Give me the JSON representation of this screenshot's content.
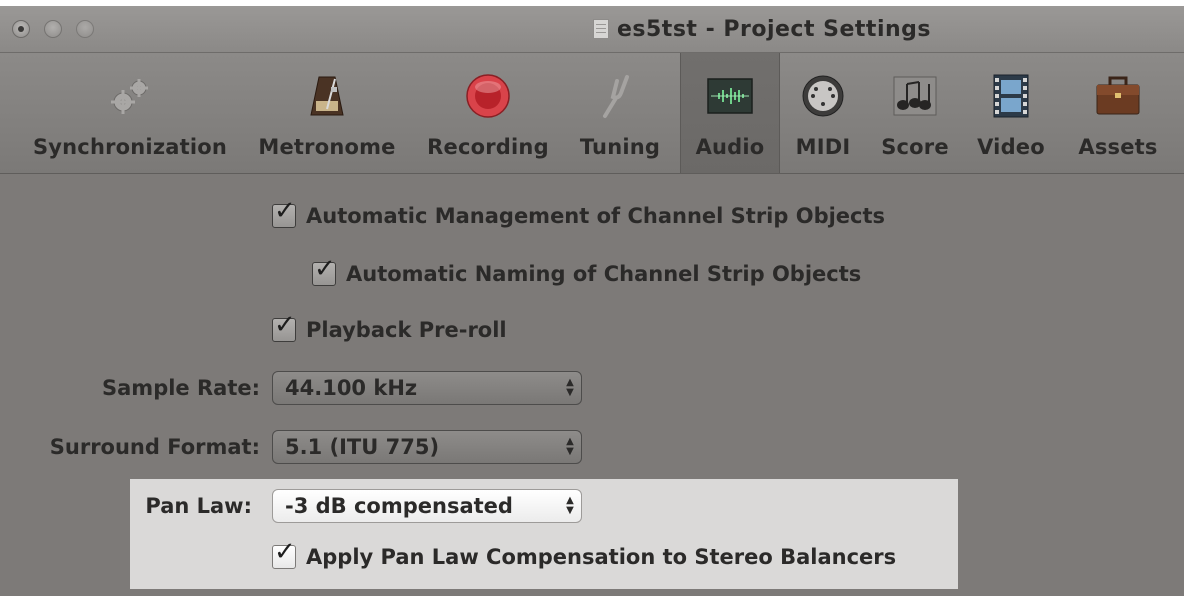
{
  "window": {
    "title": "es5tst - Project Settings"
  },
  "toolbar": {
    "items": [
      {
        "label": "Synchronization",
        "icon": "gears-icon"
      },
      {
        "label": "Metronome",
        "icon": "metronome-icon"
      },
      {
        "label": "Recording",
        "icon": "record-icon"
      },
      {
        "label": "Tuning",
        "icon": "tuning-fork-icon"
      },
      {
        "label": "Audio",
        "icon": "audio-waveform-icon",
        "selected": true
      },
      {
        "label": "MIDI",
        "icon": "midi-connector-icon"
      },
      {
        "label": "Score",
        "icon": "music-notes-icon"
      },
      {
        "label": "Video",
        "icon": "film-strip-icon"
      },
      {
        "label": "Assets",
        "icon": "briefcase-icon"
      }
    ]
  },
  "audio": {
    "auto_management": {
      "label": "Automatic Management of Channel Strip Objects",
      "checked": true
    },
    "auto_naming": {
      "label": "Automatic Naming of Channel Strip Objects",
      "checked": true
    },
    "playback_preroll": {
      "label": "Playback Pre-roll",
      "checked": true
    },
    "sample_rate": {
      "label": "Sample Rate:",
      "value": "44.100 kHz"
    },
    "surround_format": {
      "label": "Surround Format:",
      "value": "5.1 (ITU 775)"
    },
    "pan_law": {
      "label": "Pan Law:",
      "value": "-3 dB compensated"
    },
    "apply_pan_law": {
      "label": "Apply Pan Law Compensation to Stereo Balancers",
      "checked": true
    }
  },
  "glyphs": {
    "check": "✓",
    "up": "▲",
    "down": "▼"
  },
  "colors": {
    "window_bg": "#7d7a78",
    "highlight_bg": "#dad9d8",
    "record_red": "#d9434a"
  }
}
